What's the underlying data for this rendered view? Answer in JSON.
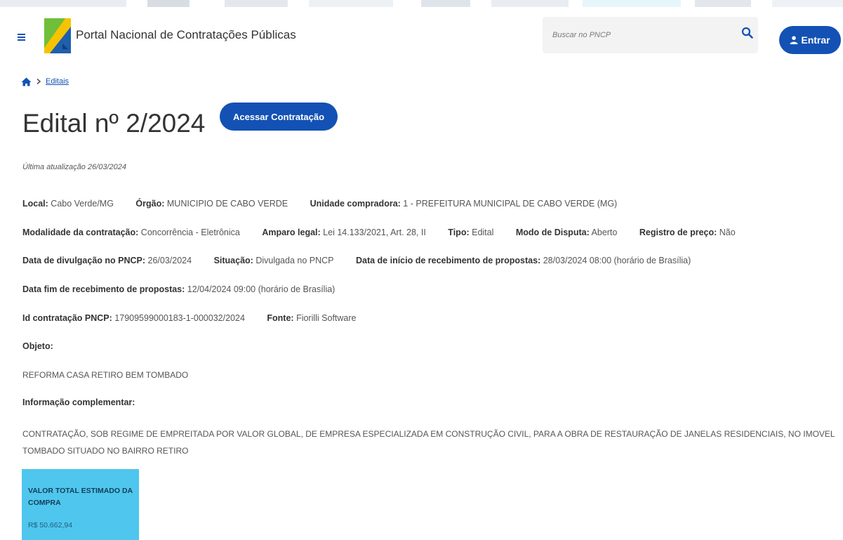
{
  "colors": {
    "primary": "#1351b4",
    "card_bg": "#4fc6ed",
    "text": "#333333",
    "muted_text": "#555555"
  },
  "header": {
    "title": "Portal Nacional de Contratações Públicas",
    "search_placeholder": "Buscar no PNCP",
    "login_label": "Entrar",
    "icons": [
      "menu-icon",
      "portal-logo",
      "search-icon",
      "user-icon"
    ]
  },
  "breadcrumb": {
    "home_icon": "home-icon",
    "separator": "›",
    "link": "Editais"
  },
  "page": {
    "title": "Edital nº 2/2024",
    "access_button": "Acessar Contratação",
    "last_update": "Última atualização 26/03/2024"
  },
  "details": {
    "local_label": "Local:",
    "local_value": "Cabo Verde/MG",
    "orgao_label": "Órgão:",
    "orgao_value": "MUNICIPIO DE CABO VERDE",
    "unidade_label": "Unidade compradora:",
    "unidade_value": "1 - PREFEITURA MUNICIPAL DE CABO VERDE (MG)",
    "modalidade_label": "Modalidade da contratação:",
    "modalidade_value": "Concorrência - Eletrônica",
    "amparo_label": "Amparo legal:",
    "amparo_value": "Lei 14.133/2021, Art. 28, II",
    "tipo_label": "Tipo:",
    "tipo_value": "Edital",
    "disputa_label": "Modo de Disputa:",
    "disputa_value": "Aberto",
    "registro_label": "Registro de preço:",
    "registro_value": "Não",
    "divulgacao_label": "Data de divulgação no PNCP:",
    "divulgacao_value": "26/03/2024",
    "situacao_label": "Situação:",
    "situacao_value": "Divulgada no PNCP",
    "inicio_label": "Data de início de recebimento de propostas:",
    "inicio_value": "28/03/2024 08:00 (horário de Brasília)",
    "fim_label": "Data fim de recebimento de propostas:",
    "fim_value": "12/04/2024 09:00 (horário de Brasília)",
    "id_label": "Id contratação PNCP:",
    "id_value": "17909599000183-1-000032/2024",
    "fonte_label": "Fonte:",
    "fonte_value": "Fiorilli Software"
  },
  "objeto": {
    "label": "Objeto:",
    "text": "REFORMA CASA RETIRO BEM TOMBADO"
  },
  "informacao": {
    "label": "Informação complementar:",
    "text": "CONTRATAÇÃO, SOB REGIME DE EMPREITADA POR VALOR GLOBAL, DE EMPRESA ESPECIALIZADA EM CONSTRUÇÃO CIVIL, PARA A OBRA DE RESTAURAÇÃO DE JANELAS RESIDENCIAIS, NO IMOVEL TOMBADO SITUADO NO BAIRRO RETIRO"
  },
  "valor": {
    "label": "VALOR TOTAL ESTIMADO DA COMPRA",
    "amount": "R$ 50.662,94"
  }
}
